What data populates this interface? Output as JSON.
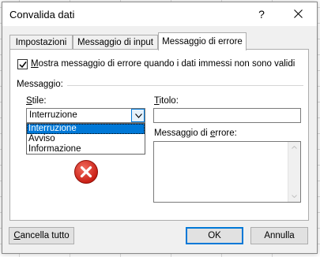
{
  "dialog": {
    "title": "Convalida dati",
    "help_label": "?",
    "close_icon": "close-icon"
  },
  "tabs": [
    {
      "label": "Impostazioni",
      "active": false
    },
    {
      "label": "Messaggio di input",
      "active": false
    },
    {
      "label": "Messaggio di errore",
      "active": true
    }
  ],
  "error_tab": {
    "show_error_checkbox": {
      "checked": true,
      "label_prefix": "M",
      "label_rest": "ostra messaggio di errore quando i dati immessi non sono validi"
    },
    "group_label": "Messaggio:",
    "style_label_prefix": "S",
    "style_label_rest": "tile:",
    "style_value": "Interruzione",
    "style_options": [
      "Interruzione",
      "Avviso",
      "Informazione"
    ],
    "selected_option_index": 0,
    "style_icon": "error-stop-icon",
    "title_label_prefix": "T",
    "title_label_rest": "itolo:",
    "title_value": "",
    "error_message_label_prefix": "Messaggio di ",
    "error_message_label_u": "e",
    "error_message_label_rest": "rrore:",
    "error_message_value": ""
  },
  "footer": {
    "clear_all_prefix": "C",
    "clear_all_rest": "ancella tutto",
    "ok_label": "OK",
    "cancel_label": "Annulla"
  },
  "colors": {
    "accent": "#0078d7",
    "error_icon_red": "#d9281e"
  }
}
